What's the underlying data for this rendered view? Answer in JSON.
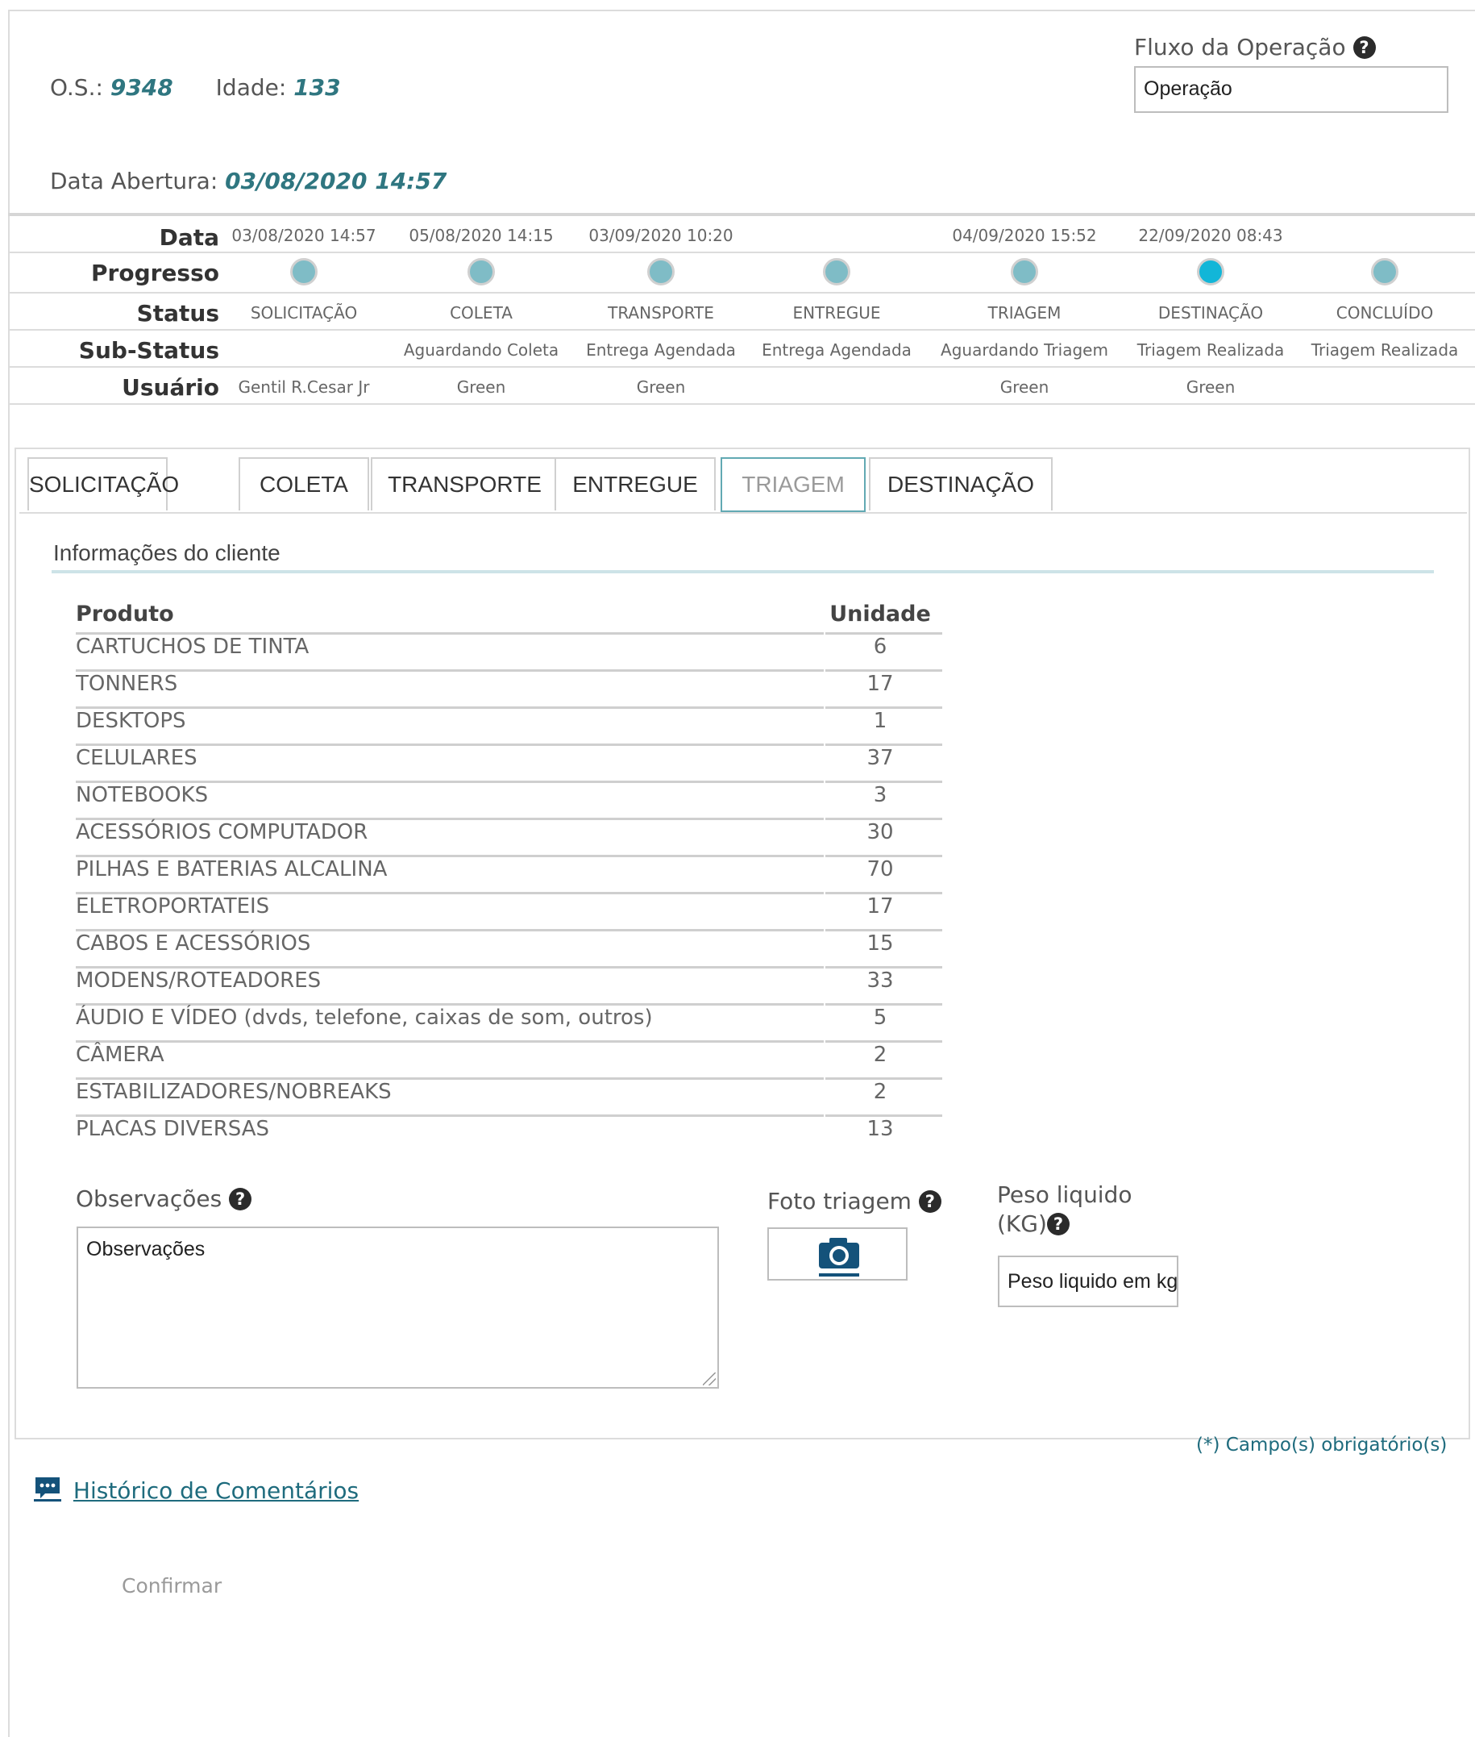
{
  "header": {
    "os_label": "O.S.:",
    "os_value": "9348",
    "idade_label": "Idade:",
    "idade_value": "133",
    "data_abertura_label": "Data Abertura:",
    "data_abertura_value": "03/08/2020 14:57",
    "fluxo_label": "Fluxo da Operação",
    "fluxo_placeholder": "Operação"
  },
  "progress": {
    "row_labels": {
      "data": "Data",
      "progresso": "Progresso",
      "status": "Status",
      "substatus": "Sub-Status",
      "usuario": "Usuário"
    },
    "steps": [
      {
        "data": "03/08/2020 14:57",
        "status": "SOLICITAÇÃO",
        "substatus": "",
        "usuario": "Gentil R.Cesar Jr",
        "active": false
      },
      {
        "data": "05/08/2020 14:15",
        "status": "COLETA",
        "substatus": "Aguardando Coleta",
        "usuario": "Green",
        "active": false
      },
      {
        "data": "03/09/2020 10:20",
        "status": "TRANSPORTE",
        "substatus": "Entrega Agendada",
        "usuario": "Green",
        "active": false
      },
      {
        "data": "",
        "status": "ENTREGUE",
        "substatus": "Entrega Agendada",
        "usuario": "",
        "active": false
      },
      {
        "data": "04/09/2020 15:52",
        "status": "TRIAGEM",
        "substatus": "Aguardando Triagem",
        "usuario": "Green",
        "active": false
      },
      {
        "data": "22/09/2020 08:43",
        "status": "DESTINAÇÃO",
        "substatus": "Triagem Realizada",
        "usuario": "Green",
        "active": true
      },
      {
        "data": "",
        "status": "CONCLUÍDO",
        "substatus": "Triagem Realizada",
        "usuario": "",
        "active": false
      }
    ]
  },
  "tabs": [
    {
      "label": "SOLICITAÇÃO",
      "active": false
    },
    {
      "label": "COLETA",
      "active": false
    },
    {
      "label": "TRANSPORTE",
      "active": false
    },
    {
      "label": "ENTREGUE",
      "active": false
    },
    {
      "label": "TRIAGEM",
      "active": true
    },
    {
      "label": "DESTINAÇÃO",
      "active": false
    }
  ],
  "section_title": "Informações do cliente",
  "products": {
    "headers": {
      "produto": "Produto",
      "unidade": "Unidade"
    },
    "rows": [
      {
        "produto": "CARTUCHOS DE TINTA",
        "unidade": "6"
      },
      {
        "produto": "TONNERS",
        "unidade": "17"
      },
      {
        "produto": "DESKTOPS",
        "unidade": "1"
      },
      {
        "produto": "CELULARES",
        "unidade": "37"
      },
      {
        "produto": "NOTEBOOKS",
        "unidade": "3"
      },
      {
        "produto": "ACESSÓRIOS COMPUTADOR",
        "unidade": "30"
      },
      {
        "produto": "PILHAS E BATERIAS ALCALINA",
        "unidade": "70"
      },
      {
        "produto": "ELETROPORTATEIS",
        "unidade": "17"
      },
      {
        "produto": "CABOS E ACESSÓRIOS",
        "unidade": "15"
      },
      {
        "produto": "MODENS/ROTEADORES",
        "unidade": "33"
      },
      {
        "produto": "ÁUDIO E VÍDEO (dvds, telefone, caixas de som, outros)",
        "unidade": "5"
      },
      {
        "produto": "CÂMERA",
        "unidade": "2"
      },
      {
        "produto": "ESTABILIZADORES/NOBREAKS",
        "unidade": "2"
      },
      {
        "produto": "PLACAS DIVERSAS",
        "unidade": "13"
      }
    ]
  },
  "form": {
    "observacoes_label": "Observações",
    "observacoes_placeholder": "Observações",
    "foto_label": "Foto triagem",
    "foto_icon": "camera-icon",
    "peso_label_1": "Peso liquido",
    "peso_label_2": "(KG)",
    "peso_placeholder": "Peso liquido em kg",
    "help_icon": "question-circle-icon"
  },
  "required_note": "(*) Campo(s) obrigatório(s)",
  "historico_label": "Histórico de Comentários",
  "historico_icon": "comment-icon",
  "confirm_label": "Confirmar",
  "colors": {
    "accent": "#2f7680",
    "active_dot": "#12b6d8",
    "dot": "#7fbcc6",
    "link": "#1e6b7d"
  }
}
